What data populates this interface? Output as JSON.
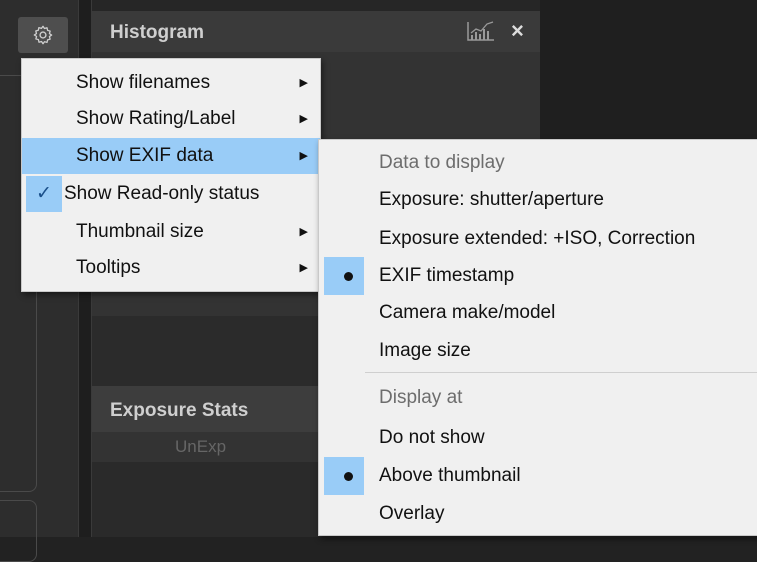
{
  "histogram": {
    "title": "Histogram",
    "close_glyph": "×",
    "chart_icon": "histogram-chart-icon"
  },
  "exposure_stats": {
    "title": "Exposure Stats",
    "column": "UnExp"
  },
  "menu": {
    "items": [
      {
        "label": "Show filenames",
        "submenu": true
      },
      {
        "label": "Show Rating/Label",
        "submenu": true
      },
      {
        "label": "Show EXIF data",
        "submenu": true,
        "highlighted": true
      },
      {
        "label": "Show Read-only status",
        "checked": true
      },
      {
        "label": "Thumbnail size",
        "submenu": true
      },
      {
        "label": "Tooltips",
        "submenu": true
      }
    ],
    "check_glyph": "✓",
    "arrow_glyph": "▶"
  },
  "submenu": {
    "section1": "Data to display",
    "items1": [
      {
        "label": "Exposure: shutter/aperture",
        "selected": false
      },
      {
        "label": "Exposure extended: +ISO, Correction",
        "selected": false
      },
      {
        "label": "EXIF timestamp",
        "selected": true
      },
      {
        "label": "Camera make/model",
        "selected": false
      },
      {
        "label": "Image size",
        "selected": false
      }
    ],
    "section2": "Display at",
    "items2": [
      {
        "label": "Do not show",
        "selected": false
      },
      {
        "label": "Above thumbnail",
        "selected": true
      },
      {
        "label": "Overlay",
        "selected": false
      }
    ]
  },
  "colors": {
    "highlight": "#99ccf7",
    "menu_bg": "#f0f0f0"
  }
}
